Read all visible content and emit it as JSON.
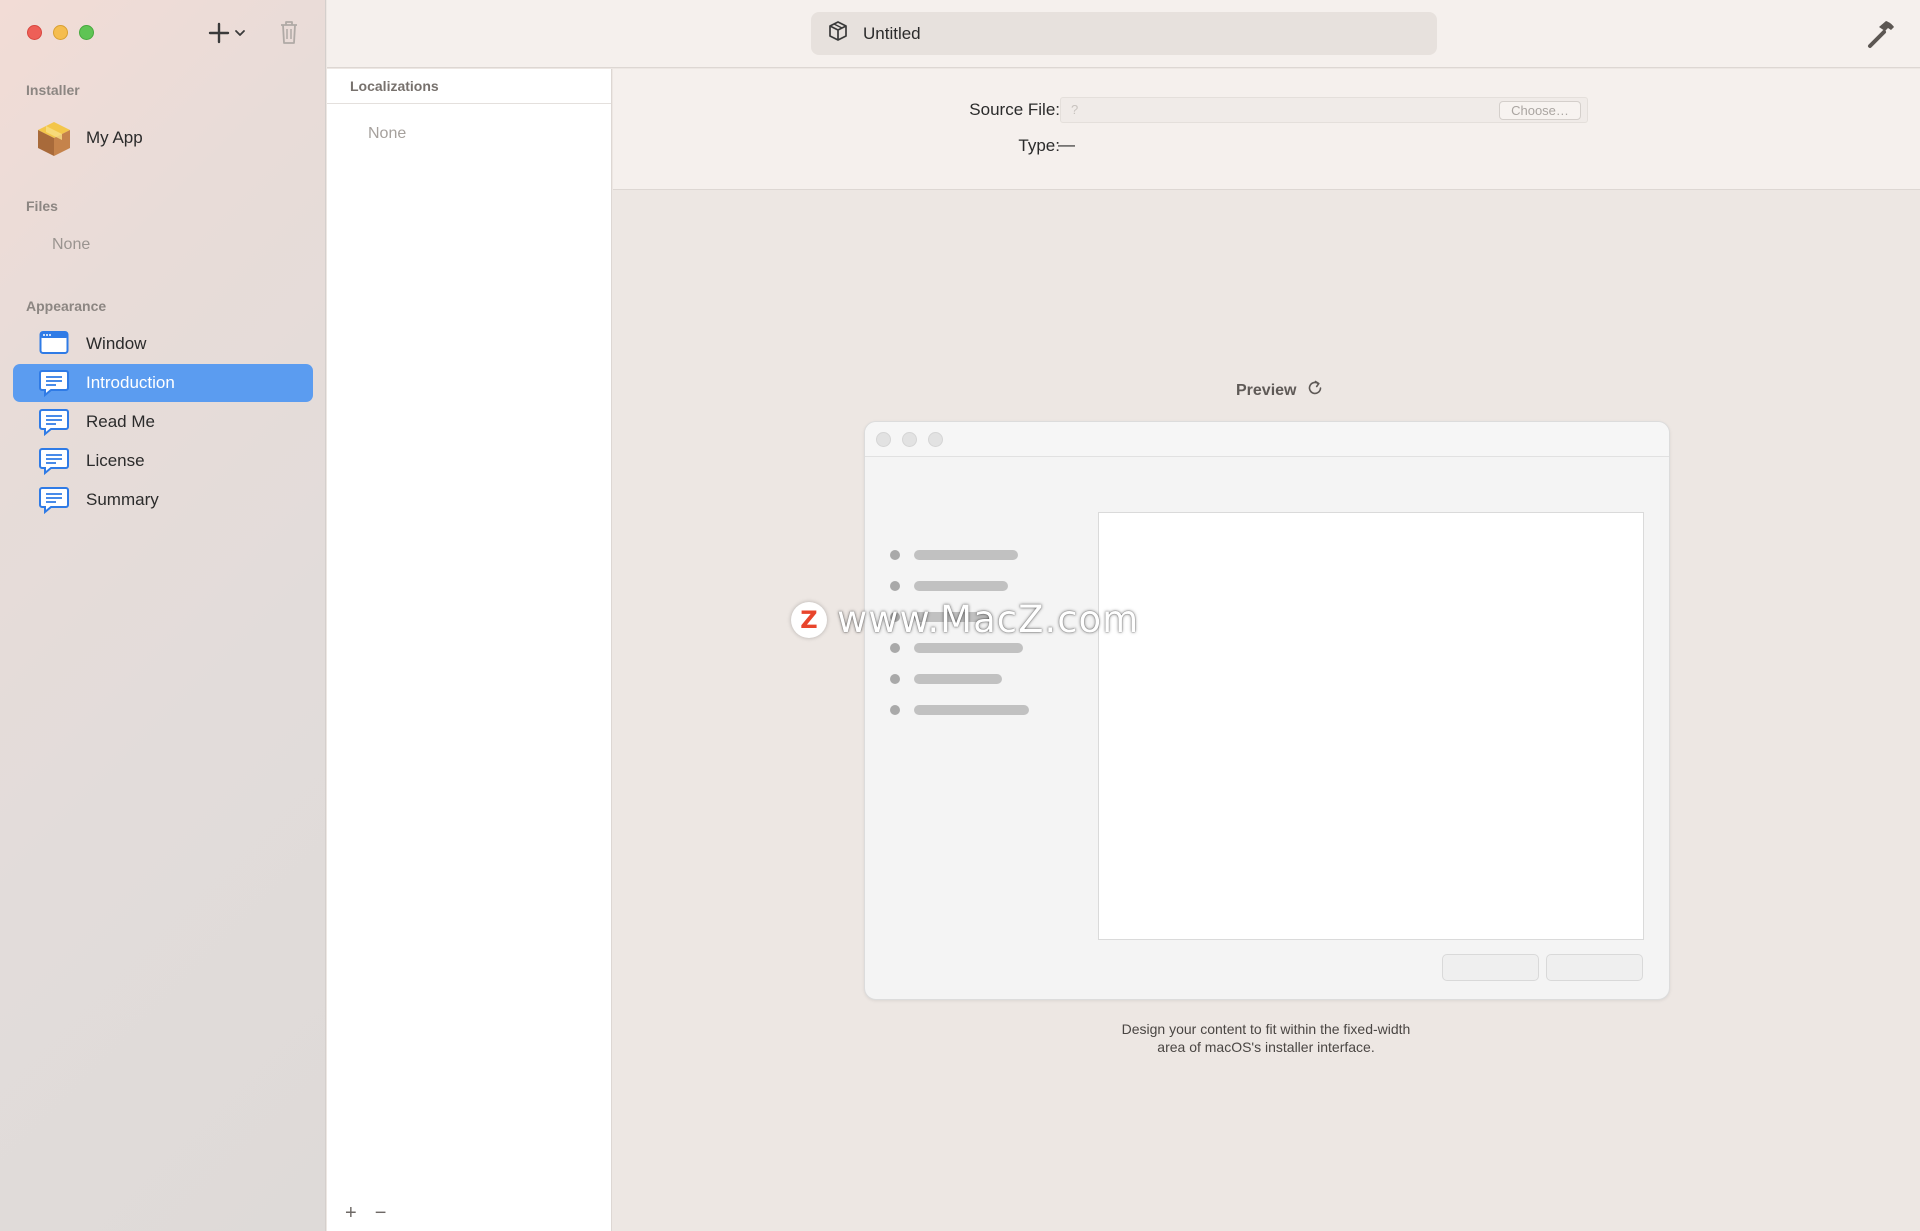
{
  "window": {
    "title": "Untitled"
  },
  "sidebar": {
    "installer_label": "Installer",
    "app_name": "My App",
    "files_label": "Files",
    "files_none": "None",
    "appearance_label": "Appearance",
    "items": [
      {
        "label": "Window",
        "icon": "window-icon",
        "active": false
      },
      {
        "label": "Introduction",
        "icon": "speech-bubble-icon",
        "active": true
      },
      {
        "label": "Read Me",
        "icon": "speech-bubble-icon",
        "active": false
      },
      {
        "label": "License",
        "icon": "speech-bubble-icon",
        "active": false
      },
      {
        "label": "Summary",
        "icon": "speech-bubble-icon",
        "active": false
      }
    ]
  },
  "localizations": {
    "header": "Localizations",
    "none": "None",
    "add_symbol": "+",
    "remove_symbol": "−"
  },
  "detail": {
    "source_file_label": "Source File:",
    "source_file_placeholder": "?",
    "choose_label": "Choose…",
    "type_label": "Type:",
    "type_value": "—"
  },
  "preview": {
    "title": "Preview",
    "note_line1": "Design your content to fit within the fixed-width",
    "note_line2": "area of macOS's installer interface."
  },
  "watermark": {
    "logo": "Z",
    "text": "www.MacZ.com"
  },
  "colors": {
    "accent": "#5b9cf0",
    "icon_blue": "#2f7be6",
    "close": "#ee5f57",
    "minimize": "#f5bd4f",
    "zoom": "#5fc454"
  }
}
